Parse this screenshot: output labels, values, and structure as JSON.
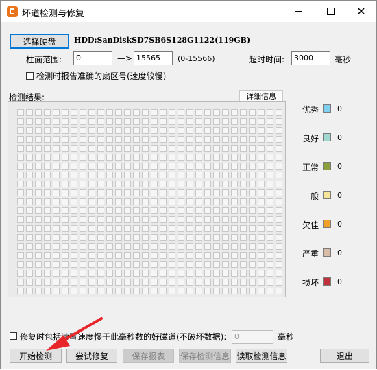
{
  "window": {
    "title": "坏道检测与修复"
  },
  "header": {
    "select_disk_label": "选择硬盘",
    "disk_info": "HDD:SanDiskSD7SB6S128G1122(119GB)",
    "cylinder_range_label": "柱面范围:",
    "cylinder_from": "0",
    "arrow_text": "—>",
    "cylinder_to": "15565",
    "cylinder_hint": "(0-15566)",
    "timeout_label": "超时时间:",
    "timeout_value": "3000",
    "timeout_unit": "毫秒",
    "report_sector_label": "检测时报告准确的扇区号(速度较慢)",
    "report_sector_checked": false
  },
  "results": {
    "label": "检测结果:",
    "detail_button": "详细信息"
  },
  "legend": [
    {
      "label": "优秀",
      "color": "#7fcff0",
      "count": "0"
    },
    {
      "label": "良好",
      "color": "#9ed8cf",
      "count": "0"
    },
    {
      "label": "正常",
      "color": "#8aa03a",
      "count": "0"
    },
    {
      "label": "一般",
      "color": "#f4e59a",
      "count": "0"
    },
    {
      "label": "欠佳",
      "color": "#f0a028",
      "count": "0"
    },
    {
      "label": "严重",
      "color": "#d8bca8",
      "count": "0"
    },
    {
      "label": "损坏",
      "color": "#c0313c",
      "count": "0"
    }
  ],
  "repair_option": {
    "label": "修复时包括读写速度慢于此毫秒数的好磁道(不破坏数据):",
    "value": "0",
    "unit": "毫秒",
    "checked": false
  },
  "buttons": {
    "start": "开始检测",
    "repair": "尝试修复",
    "save_report": "保存报表",
    "save_info": "保存检测信息",
    "read_info": "读取检测信息",
    "exit": "退出"
  },
  "colors": {
    "accent": "#0078d7",
    "arrow": "#e8262a"
  }
}
